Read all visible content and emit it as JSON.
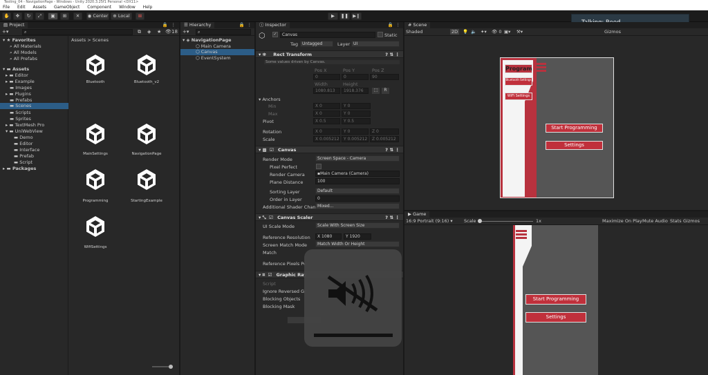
{
  "window": {
    "title": "Testing_04 - NavigationPage - Windows - Unity 2020.3.25f1 Personal <DX11>"
  },
  "menu": [
    "File",
    "Edit",
    "Assets",
    "GameObject",
    "Component",
    "Window",
    "Help"
  ],
  "toolbar": {
    "pivot_label": "Center",
    "space_label": "Local"
  },
  "toast": {
    "text": "Talking: Reed"
  },
  "project": {
    "tab": "Project",
    "count": "18",
    "favorites_label": "Favorites",
    "favorites": [
      "All Materials",
      "All Models",
      "All Prefabs"
    ],
    "assets_label": "Assets",
    "tree": [
      "Editor",
      "Example",
      "Images",
      "Plugins",
      "Prefabs",
      "Scenes",
      "Scripts",
      "Sprites",
      "TextMesh Pro",
      "UniWebView"
    ],
    "uniwebview_children": [
      "Demo",
      "Editor",
      "Interface",
      "Prefab",
      "Script"
    ],
    "packages_label": "Packages",
    "breadcrumb": [
      "Assets",
      "Scenes"
    ],
    "scenes": [
      "Bluetooth",
      "Bluetooth_v2",
      "MainSettings",
      "NavigationPage",
      "Programming",
      "StartingExample",
      "WifiSettings"
    ]
  },
  "hierarchy": {
    "tab": "Hierarchy",
    "scene": "NavigationPage",
    "items": [
      "Main Camera",
      "Canvas",
      "EventSystem"
    ]
  },
  "inspector": {
    "tab": "Inspector",
    "object_name": "Canvas",
    "static_label": "Static",
    "tag_label": "Tag",
    "tag_value": "Untagged",
    "layer_label": "Layer",
    "layer_value": "UI",
    "rect_transform": {
      "title": "Rect Transform",
      "note": "Some values driven by Canvas.",
      "posx_label": "Pos X",
      "posy_label": "Pos Y",
      "posz_label": "Pos Z",
      "posx": "0",
      "posy": "0",
      "posz": "90",
      "width_label": "Width",
      "height_label": "Height",
      "width": "1080.813",
      "height": "1918.376",
      "anchors_label": "Anchors",
      "min_label": "Min",
      "max_label": "Max",
      "min_x": "0",
      "min_y": "0",
      "max_x": "0",
      "max_y": "0",
      "pivot_label": "Pivot",
      "pivot_x": "0.5",
      "pivot_y": "0.5",
      "rotation_label": "Rotation",
      "rot_x": "0",
      "rot_y": "0",
      "rot_z": "0",
      "scale_label": "Scale",
      "scale_x": "0.005212",
      "scale_y": "0.005212",
      "scale_z": "0.005212"
    },
    "canvas": {
      "title": "Canvas",
      "render_mode_label": "Render Mode",
      "render_mode": "Screen Space - Camera",
      "pixel_perfect_label": "Pixel Perfect",
      "render_camera_label": "Render Camera",
      "render_camera": "Main Camera (Camera)",
      "plane_distance_label": "Plane Distance",
      "plane_distance": "100",
      "sorting_layer_label": "Sorting Layer",
      "sorting_layer": "Default",
      "order_label": "Order in Layer",
      "order": "0",
      "shader_label": "Additional Shader Chann",
      "shader": "Mixed..."
    },
    "scaler": {
      "title": "Canvas Scaler",
      "scale_mode_label": "UI Scale Mode",
      "scale_mode": "Scale With Screen Size",
      "ref_res_label": "Reference Resolution",
      "ref_x": "1080",
      "ref_y": "1920",
      "match_mode_label": "Screen Match Mode",
      "match_mode": "Match Width Or Height",
      "match_label": "Match",
      "ref_px_label": "Reference Pixels Pe"
    },
    "raycaster": {
      "title": "Graphic Ray",
      "script_label": "Script",
      "ignore_label": "Ignore Reversed Gr",
      "blocking_objects_label": "Blocking Objects",
      "blocking_mask_label": "Blocking Mask"
    }
  },
  "scene_view": {
    "tab": "Scene",
    "shading": "Shaded",
    "mode_2d": "2D",
    "gizmos": "Gizmos",
    "program_label": "Program",
    "bluetooth_label": "Bluetooth Settings",
    "wifi_label": "WiFi Settings",
    "start_label": "Start Programming",
    "settings_label": "Settings"
  },
  "game_view": {
    "tab": "Game",
    "aspect": "16:9 Portrait (9:16)",
    "scale_label": "Scale",
    "scale_value": "1x",
    "maximize": "Maximize On Play",
    "mute": "Mute Audio",
    "stats": "Stats",
    "gizmos": "Gizmos",
    "start_label": "Start Programming",
    "settings_label": "Settings"
  },
  "colors": {
    "accent_red": "#c0303b",
    "selection": "#2c5d87",
    "toast_bg": "#2b3a45"
  },
  "overlay": {
    "icon": "speaker-muted-icon"
  }
}
